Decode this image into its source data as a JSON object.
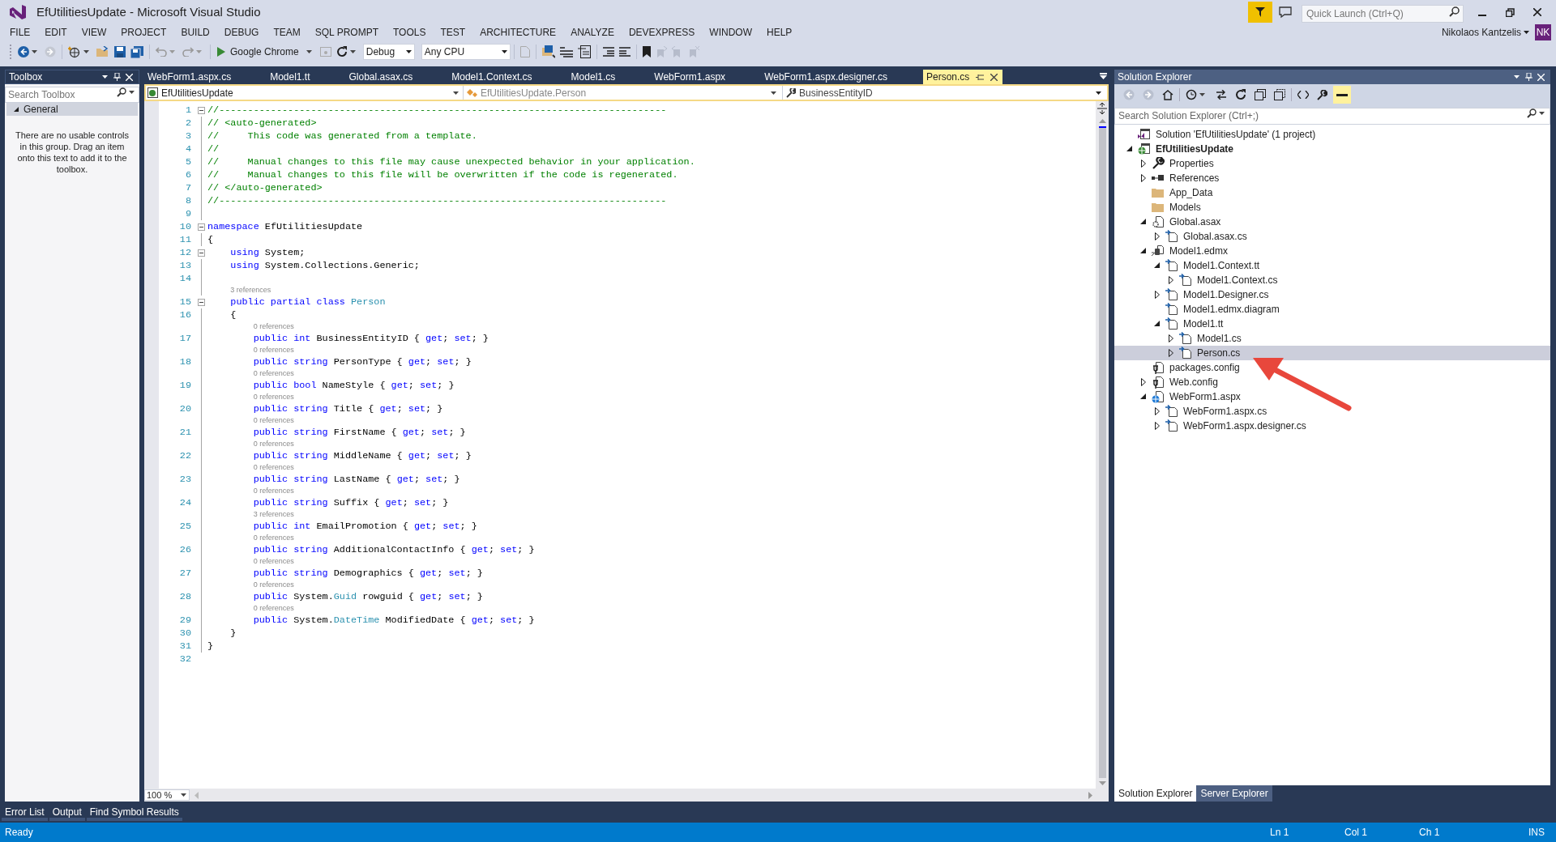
{
  "window": {
    "title": "EfUtilitiesUpdate - Microsoft Visual Studio",
    "quick_launch": {
      "placeholder": "Quick Launch (Ctrl+Q)"
    },
    "user": {
      "name": "Nikolaos Kantzelis",
      "initials": "NK"
    }
  },
  "menu": [
    "FILE",
    "EDIT",
    "VIEW",
    "PROJECT",
    "BUILD",
    "DEBUG",
    "TEAM",
    "SQL PROMPT",
    "TOOLS",
    "TEST",
    "ARCHITECTURE",
    "ANALYZE",
    "DEVEXPRESS",
    "WINDOW",
    "HELP"
  ],
  "toolbar": {
    "run_target": "Google Chrome",
    "configuration": "Debug",
    "platform": "Any CPU"
  },
  "toolbox": {
    "title": "Toolbox",
    "search": {
      "placeholder": "Search Toolbox"
    },
    "groups": [
      {
        "label": "General",
        "expanded": true,
        "empty_message": "There are no usable controls in this group. Drag an item onto this text to add it to the toolbox."
      }
    ]
  },
  "document_tabs": [
    {
      "label": "WebForm1.aspx.cs",
      "selected": false
    },
    {
      "label": "Model1.tt",
      "selected": false
    },
    {
      "label": "Global.asax.cs",
      "selected": false
    },
    {
      "label": "Model1.Context.cs",
      "selected": false
    },
    {
      "label": "Model1.cs",
      "selected": false
    },
    {
      "label": "WebForm1.aspx",
      "selected": false
    },
    {
      "label": "WebForm1.aspx.designer.cs",
      "selected": false
    },
    {
      "label": "Person.cs",
      "selected": true
    }
  ],
  "editor": {
    "navigation": {
      "project": "EfUtilitiesUpdate",
      "type": "EfUtilitiesUpdate.Person",
      "member": "BusinessEntityID"
    },
    "zoom": "100 %",
    "lines": [
      {
        "number": "1",
        "fold": true,
        "tokens": [
          {
            "kind": "comment",
            "text": "//------------------------------------------------------------------------------"
          }
        ]
      },
      {
        "number": "2",
        "tokens": [
          {
            "kind": "comment",
            "text": "// <auto-generated>"
          }
        ]
      },
      {
        "number": "3",
        "tokens": [
          {
            "kind": "comment",
            "text": "//     This code was generated from a template."
          }
        ]
      },
      {
        "number": "4",
        "tokens": [
          {
            "kind": "comment",
            "text": "//"
          }
        ]
      },
      {
        "number": "5",
        "tokens": [
          {
            "kind": "comment",
            "text": "//     Manual changes to this file may cause unexpected behavior in your application."
          }
        ]
      },
      {
        "number": "6",
        "tokens": [
          {
            "kind": "comment",
            "text": "//     Manual changes to this file will be overwritten if the code is regenerated."
          }
        ]
      },
      {
        "number": "7",
        "tokens": [
          {
            "kind": "comment",
            "text": "// </auto-generated>"
          }
        ]
      },
      {
        "number": "8",
        "tokens": [
          {
            "kind": "comment",
            "text": "//------------------------------------------------------------------------------"
          }
        ]
      },
      {
        "number": "9"
      },
      {
        "number": "10",
        "fold": true,
        "tokens": [
          {
            "kind": "keyword",
            "text": "namespace"
          },
          {
            "kind": "plain",
            "text": " EfUtilitiesUpdate"
          }
        ]
      },
      {
        "number": "11",
        "tokens": [
          {
            "kind": "plain",
            "text": "{"
          }
        ]
      },
      {
        "number": "12",
        "fold": true,
        "tokens": [
          {
            "kind": "keyword",
            "text": "    using"
          },
          {
            "kind": "plain",
            "text": " System;"
          }
        ]
      },
      {
        "number": "13",
        "tokens": [
          {
            "kind": "keyword",
            "text": "    using"
          },
          {
            "kind": "plain",
            "text": " System.Collections.Generic;"
          }
        ]
      },
      {
        "number": "14"
      },
      {
        "number": "15",
        "fold": true,
        "lens": "3 references",
        "tokens": [
          {
            "kind": "keyword",
            "text": "    public partial class "
          },
          {
            "kind": "type",
            "text": "Person"
          }
        ]
      },
      {
        "number": "16",
        "tokens": [
          {
            "kind": "plain",
            "text": "    {"
          }
        ]
      },
      {
        "number": "17",
        "lens": "0 references",
        "tokens": [
          {
            "kind": "keyword",
            "text": "        public int"
          },
          {
            "kind": "plain",
            "text": " BusinessEntityID { "
          },
          {
            "kind": "keyword",
            "text": "get"
          },
          {
            "kind": "plain",
            "text": "; "
          },
          {
            "kind": "keyword",
            "text": "set"
          },
          {
            "kind": "plain",
            "text": "; }"
          }
        ]
      },
      {
        "number": "18",
        "lens": "0 references",
        "tokens": [
          {
            "kind": "keyword",
            "text": "        public string"
          },
          {
            "kind": "plain",
            "text": " PersonType { "
          },
          {
            "kind": "keyword",
            "text": "get"
          },
          {
            "kind": "plain",
            "text": "; "
          },
          {
            "kind": "keyword",
            "text": "set"
          },
          {
            "kind": "plain",
            "text": "; }"
          }
        ]
      },
      {
        "number": "19",
        "lens": "0 references",
        "tokens": [
          {
            "kind": "keyword",
            "text": "        public bool"
          },
          {
            "kind": "plain",
            "text": " NameStyle { "
          },
          {
            "kind": "keyword",
            "text": "get"
          },
          {
            "kind": "plain",
            "text": "; "
          },
          {
            "kind": "keyword",
            "text": "set"
          },
          {
            "kind": "plain",
            "text": "; }"
          }
        ]
      },
      {
        "number": "20",
        "lens": "0 references",
        "tokens": [
          {
            "kind": "keyword",
            "text": "        public string"
          },
          {
            "kind": "plain",
            "text": " Title { "
          },
          {
            "kind": "keyword",
            "text": "get"
          },
          {
            "kind": "plain",
            "text": "; "
          },
          {
            "kind": "keyword",
            "text": "set"
          },
          {
            "kind": "plain",
            "text": "; }"
          }
        ]
      },
      {
        "number": "21",
        "lens": "0 references",
        "tokens": [
          {
            "kind": "keyword",
            "text": "        public string"
          },
          {
            "kind": "plain",
            "text": " FirstName { "
          },
          {
            "kind": "keyword",
            "text": "get"
          },
          {
            "kind": "plain",
            "text": "; "
          },
          {
            "kind": "keyword",
            "text": "set"
          },
          {
            "kind": "plain",
            "text": "; }"
          }
        ]
      },
      {
        "number": "22",
        "lens": "0 references",
        "tokens": [
          {
            "kind": "keyword",
            "text": "        public string"
          },
          {
            "kind": "plain",
            "text": " MiddleName { "
          },
          {
            "kind": "keyword",
            "text": "get"
          },
          {
            "kind": "plain",
            "text": "; "
          },
          {
            "kind": "keyword",
            "text": "set"
          },
          {
            "kind": "plain",
            "text": "; }"
          }
        ]
      },
      {
        "number": "23",
        "lens": "0 references",
        "tokens": [
          {
            "kind": "keyword",
            "text": "        public string"
          },
          {
            "kind": "plain",
            "text": " LastName { "
          },
          {
            "kind": "keyword",
            "text": "get"
          },
          {
            "kind": "plain",
            "text": "; "
          },
          {
            "kind": "keyword",
            "text": "set"
          },
          {
            "kind": "plain",
            "text": "; }"
          }
        ]
      },
      {
        "number": "24",
        "lens": "0 references",
        "tokens": [
          {
            "kind": "keyword",
            "text": "        public string"
          },
          {
            "kind": "plain",
            "text": " Suffix { "
          },
          {
            "kind": "keyword",
            "text": "get"
          },
          {
            "kind": "plain",
            "text": "; "
          },
          {
            "kind": "keyword",
            "text": "set"
          },
          {
            "kind": "plain",
            "text": "; }"
          }
        ]
      },
      {
        "number": "25",
        "lens": "3 references",
        "tokens": [
          {
            "kind": "keyword",
            "text": "        public int"
          },
          {
            "kind": "plain",
            "text": " EmailPromotion { "
          },
          {
            "kind": "keyword",
            "text": "get"
          },
          {
            "kind": "plain",
            "text": "; "
          },
          {
            "kind": "keyword",
            "text": "set"
          },
          {
            "kind": "plain",
            "text": "; }"
          }
        ]
      },
      {
        "number": "26",
        "lens": "0 references",
        "tokens": [
          {
            "kind": "keyword",
            "text": "        public string"
          },
          {
            "kind": "plain",
            "text": " AdditionalContactInfo { "
          },
          {
            "kind": "keyword",
            "text": "get"
          },
          {
            "kind": "plain",
            "text": "; "
          },
          {
            "kind": "keyword",
            "text": "set"
          },
          {
            "kind": "plain",
            "text": "; }"
          }
        ]
      },
      {
        "number": "27",
        "lens": "0 references",
        "tokens": [
          {
            "kind": "keyword",
            "text": "        public string"
          },
          {
            "kind": "plain",
            "text": " Demographics { "
          },
          {
            "kind": "keyword",
            "text": "get"
          },
          {
            "kind": "plain",
            "text": "; "
          },
          {
            "kind": "keyword",
            "text": "set"
          },
          {
            "kind": "plain",
            "text": "; }"
          }
        ]
      },
      {
        "number": "28",
        "lens": "0 references",
        "tokens": [
          {
            "kind": "keyword",
            "text": "        public"
          },
          {
            "kind": "plain",
            "text": " System."
          },
          {
            "kind": "type",
            "text": "Guid"
          },
          {
            "kind": "plain",
            "text": " rowguid { "
          },
          {
            "kind": "keyword",
            "text": "get"
          },
          {
            "kind": "plain",
            "text": "; "
          },
          {
            "kind": "keyword",
            "text": "set"
          },
          {
            "kind": "plain",
            "text": "; }"
          }
        ]
      },
      {
        "number": "29",
        "lens": "0 references",
        "tokens": [
          {
            "kind": "keyword",
            "text": "        public"
          },
          {
            "kind": "plain",
            "text": " System."
          },
          {
            "kind": "type",
            "text": "DateTime"
          },
          {
            "kind": "plain",
            "text": " ModifiedDate { "
          },
          {
            "kind": "keyword",
            "text": "get"
          },
          {
            "kind": "plain",
            "text": "; "
          },
          {
            "kind": "keyword",
            "text": "set"
          },
          {
            "kind": "plain",
            "text": "; }"
          }
        ]
      },
      {
        "number": "30",
        "tokens": [
          {
            "kind": "plain",
            "text": "    }"
          }
        ]
      },
      {
        "number": "31",
        "tokens": [
          {
            "kind": "plain",
            "text": "}"
          }
        ]
      },
      {
        "number": "32"
      }
    ]
  },
  "solution_explorer": {
    "title": "Solution Explorer",
    "search": {
      "placeholder": "Search Solution Explorer (Ctrl+;)"
    },
    "tree": [
      {
        "label": "Solution 'EfUtilitiesUpdate' (1 project)",
        "kind": "solution",
        "selected": false,
        "children": [
          {
            "label": "EfUtilitiesUpdate",
            "kind": "project",
            "bold": true,
            "expanded": true,
            "selected": false,
            "children": [
              {
                "label": "Properties",
                "kind": "properties",
                "expanded": false,
                "selected": false
              },
              {
                "label": "References",
                "kind": "references",
                "expanded": false,
                "selected": false
              },
              {
                "label": "App_Data",
                "kind": "folder",
                "selected": false
              },
              {
                "label": "Models",
                "kind": "folder",
                "selected": false
              },
              {
                "label": "Global.asax",
                "kind": "application",
                "expanded": true,
                "selected": false,
                "children": [
                  {
                    "label": "Global.asax.cs",
                    "kind": "code",
                    "expanded": false,
                    "selected": false
                  }
                ]
              },
              {
                "label": "Model1.edmx",
                "kind": "model",
                "expanded": true,
                "selected": false,
                "children": [
                  {
                    "label": "Model1.Context.tt",
                    "kind": "code",
                    "expanded": true,
                    "selected": false,
                    "children": [
                      {
                        "label": "Model1.Context.cs",
                        "kind": "code",
                        "expanded": false,
                        "selected": false
                      }
                    ]
                  },
                  {
                    "label": "Model1.Designer.cs",
                    "kind": "code",
                    "expanded": false,
                    "selected": false
                  },
                  {
                    "label": "Model1.edmx.diagram",
                    "kind": "code",
                    "selected": false
                  },
                  {
                    "label": "Model1.tt",
                    "kind": "code",
                    "expanded": true,
                    "selected": false,
                    "children": [
                      {
                        "label": "Model1.cs",
                        "kind": "code",
                        "expanded": false,
                        "selected": false
                      },
                      {
                        "label": "Person.cs",
                        "kind": "code",
                        "expanded": false,
                        "selected": true
                      }
                    ]
                  }
                ]
              },
              {
                "label": "packages.config",
                "kind": "config",
                "selected": false
              },
              {
                "label": "Web.config",
                "kind": "config",
                "expanded": false,
                "selected": false
              },
              {
                "label": "WebForm1.aspx",
                "kind": "webform",
                "expanded": true,
                "selected": false,
                "children": [
                  {
                    "label": "WebForm1.aspx.cs",
                    "kind": "code",
                    "expanded": false,
                    "selected": false
                  },
                  {
                    "label": "WebForm1.aspx.designer.cs",
                    "kind": "code",
                    "expanded": false,
                    "selected": false
                  }
                ]
              }
            ]
          }
        ]
      }
    ],
    "tabs": [
      {
        "label": "Solution Explorer",
        "selected": true
      },
      {
        "label": "Server Explorer",
        "selected": false
      }
    ]
  },
  "bottom_tabs": [
    "Error List",
    "Output",
    "Find Symbol Results"
  ],
  "status_bar": {
    "message": "Ready",
    "line": "Ln 1",
    "column": "Col 1",
    "char": "Ch 1",
    "mode": "INS"
  }
}
